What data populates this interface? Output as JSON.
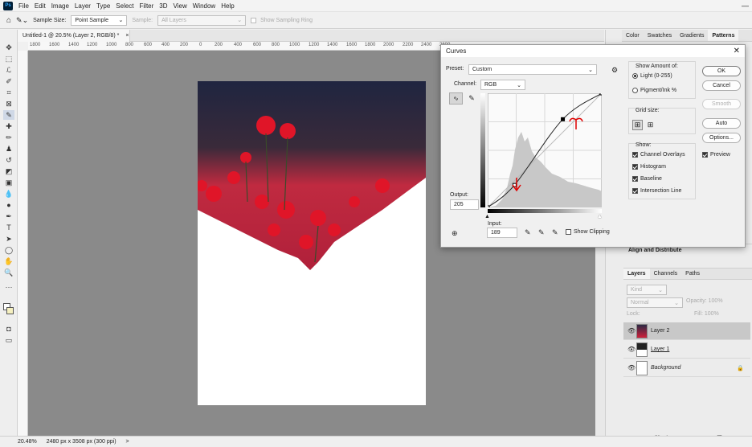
{
  "app": {
    "logo": "Ps"
  },
  "menu": [
    "File",
    "Edit",
    "Image",
    "Layer",
    "Type",
    "Select",
    "Filter",
    "3D",
    "View",
    "Window",
    "Help"
  ],
  "options": {
    "sample_size_label": "Sample Size:",
    "sample_size_value": "Point Sample",
    "sample_label": "Sample:",
    "sample_value": "All Layers",
    "show_ring": "Show Sampling Ring"
  },
  "doc": {
    "tab_title": "Untitled-1 @ 20.5% (Layer 2, RGB/8) *",
    "close": "×"
  },
  "ruler": [
    "1800",
    "1600",
    "1400",
    "1200",
    "1000",
    "800",
    "600",
    "400",
    "200",
    "0",
    "200",
    "400",
    "600",
    "800",
    "1000",
    "1200",
    "1400",
    "1600",
    "1800",
    "2000",
    "2200",
    "2400",
    "2600"
  ],
  "status": {
    "zoom": "20.48%",
    "info": "2480 px x 3508 px (300 ppi)",
    "arrow": ">"
  },
  "panels": {
    "top_tabs": [
      "Color",
      "Swatches",
      "Gradients",
      "Patterns"
    ],
    "align": "Align and Distribute",
    "layer_tabs": [
      "Layers",
      "Channels",
      "Paths"
    ],
    "kind": "Kind",
    "blend": "Normal",
    "opacity_label": "Opacity:",
    "opacity": "100%",
    "lock_label": "Lock:",
    "fill_label": "Fill:",
    "fill": "100%",
    "layers": [
      {
        "name": "Layer 2"
      },
      {
        "name": "Layer 1"
      },
      {
        "name": "Background"
      }
    ]
  },
  "curves": {
    "title": "Curves",
    "preset_label": "Preset:",
    "preset": "Custom",
    "channel_label": "Channel:",
    "channel": "RGB",
    "output_label": "Output:",
    "output": "205",
    "input_label": "Input:",
    "input": "189",
    "show_clipping": "Show Clipping",
    "show_amount": "Show Amount of:",
    "light": "Light  (0-255)",
    "pigment": "Pigment/Ink %",
    "grid_size": "Grid size:",
    "show": "Show:",
    "show_items": [
      "Channel Overlays",
      "Histogram",
      "Baseline",
      "Intersection Line"
    ],
    "buttons": {
      "ok": "OK",
      "cancel": "Cancel",
      "smooth": "Smooth",
      "auto": "Auto",
      "options": "Options..."
    },
    "preview": "Preview",
    "points": [
      [
        0,
        0
      ],
      [
        60,
        50
      ],
      [
        168,
        197
      ],
      [
        255,
        255
      ]
    ]
  },
  "colors": {
    "accent": "#31a8ff",
    "workspace": "#8a8a8a",
    "annotation": "#e00000"
  }
}
